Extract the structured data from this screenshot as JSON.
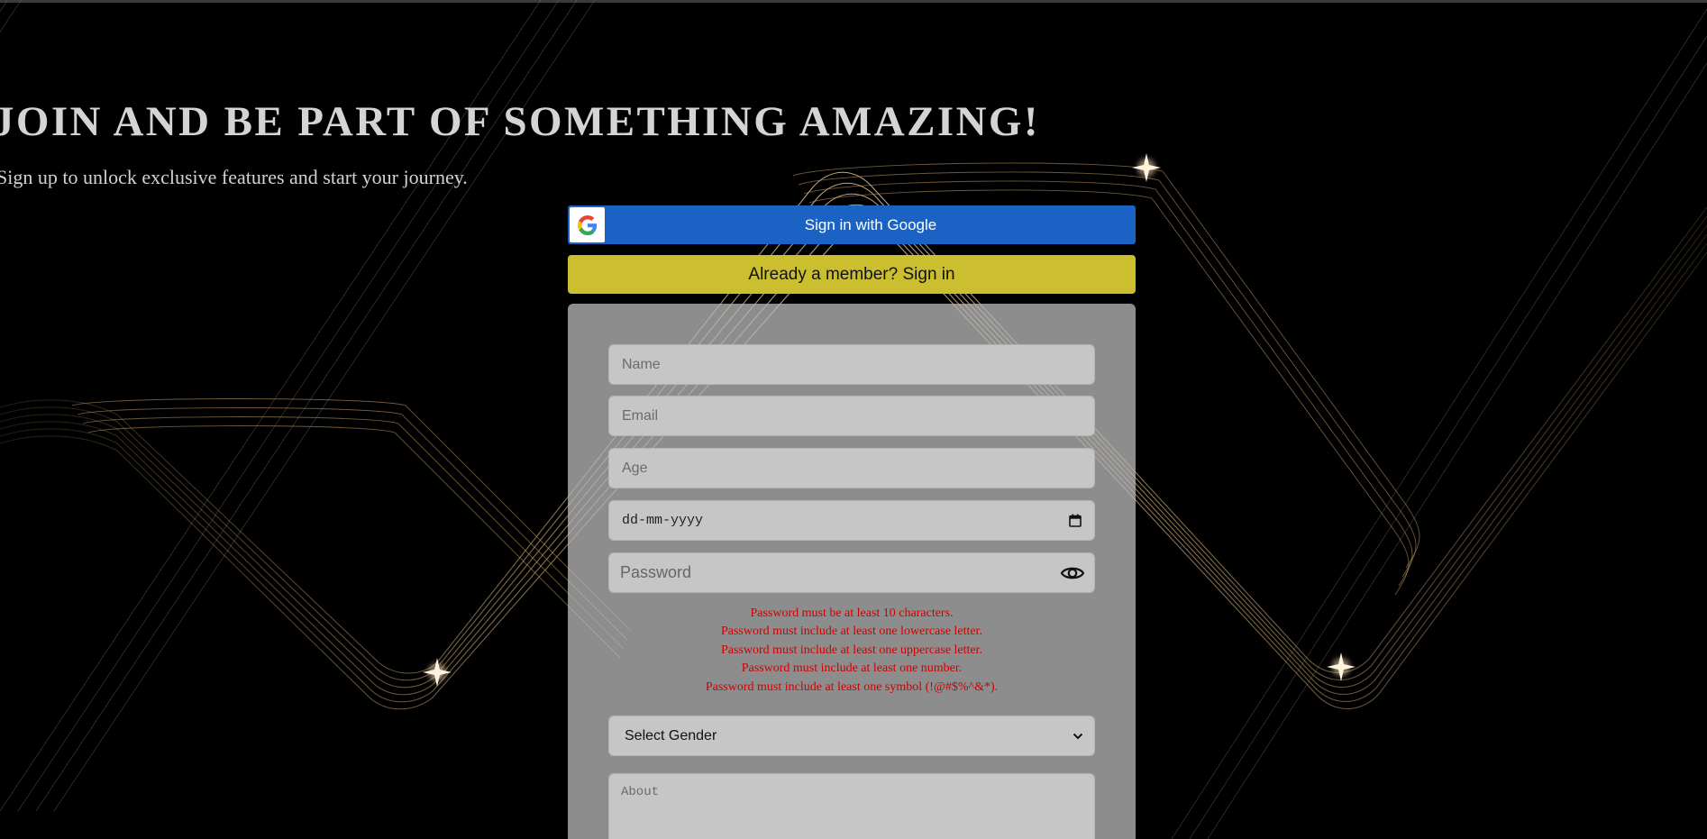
{
  "hero": {
    "title": "JOIN AND BE PART OF SOMETHING AMAZING!",
    "subtitle": "Sign up to unlock exclusive features and start your journey."
  },
  "buttons": {
    "google_label": "Sign in with Google",
    "signin_label": "Already a member? Sign in"
  },
  "form": {
    "name_placeholder": "Name",
    "email_placeholder": "Email",
    "age_placeholder": "Age",
    "date_placeholder": "dd-mm-yyyy",
    "password_placeholder": "Password",
    "password_errors": [
      "Password must be at least 10 characters.",
      "Password must include at least one lowercase letter.",
      "Password must include at least one uppercase letter.",
      "Password must include at least one number.",
      "Password must include at least one symbol (!@#$%^&*)."
    ],
    "gender_selected": "Select Gender",
    "about_placeholder": "About"
  },
  "icons": {
    "google": "google-g-icon",
    "calendar": "calendar-icon",
    "eye": "eye-icon",
    "dropdown": "chevron-down-icon"
  },
  "colors": {
    "background": "#000000",
    "google_button": "#1a62c4",
    "signin_button": "#cbbf30",
    "form_card": "#b9b9b9",
    "error_text": "#d00000",
    "decor_gold": "#c9a36a"
  }
}
